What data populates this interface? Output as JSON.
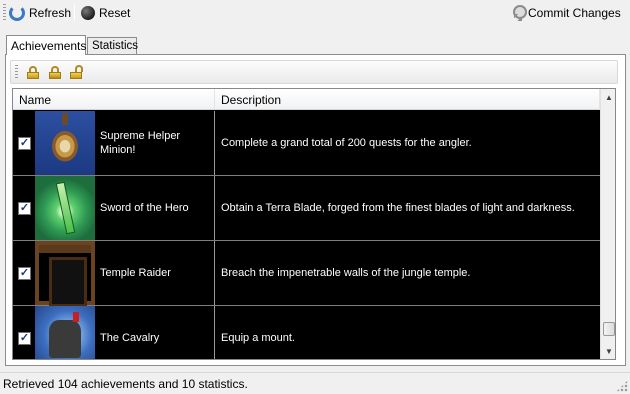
{
  "toolbar": {
    "refresh_label": "Refresh",
    "reset_label": "Reset",
    "commit_label": "Commit Changes"
  },
  "tabs": [
    {
      "label": "Achievements",
      "active": true
    },
    {
      "label": "Statistics",
      "active": false
    }
  ],
  "inner_toolbar": {
    "icons": [
      "lock-all-icon",
      "invert-lock-icon",
      "unlock-all-icon"
    ]
  },
  "list": {
    "columns": {
      "name": "Name",
      "description": "Description"
    },
    "rows": [
      {
        "name": "Supreme Helper Minion!",
        "description": "Complete a grand total of 200 quests for the angler.",
        "checked": true
      },
      {
        "name": "Sword of the Hero",
        "description": "Obtain a Terra Blade, forged from the finest blades of light and darkness.",
        "checked": true
      },
      {
        "name": "Temple Raider",
        "description": "Breach the impenetrable walls of the jungle temple.",
        "checked": true
      },
      {
        "name": "The Cavalry",
        "description": "Equip a mount.",
        "checked": true
      }
    ]
  },
  "status": {
    "text": "Retrieved 104 achievements and 10 statistics."
  },
  "colors": {
    "list_background": "#000000",
    "row_text": "#ffffff",
    "window_background": "#f0f0f0"
  }
}
